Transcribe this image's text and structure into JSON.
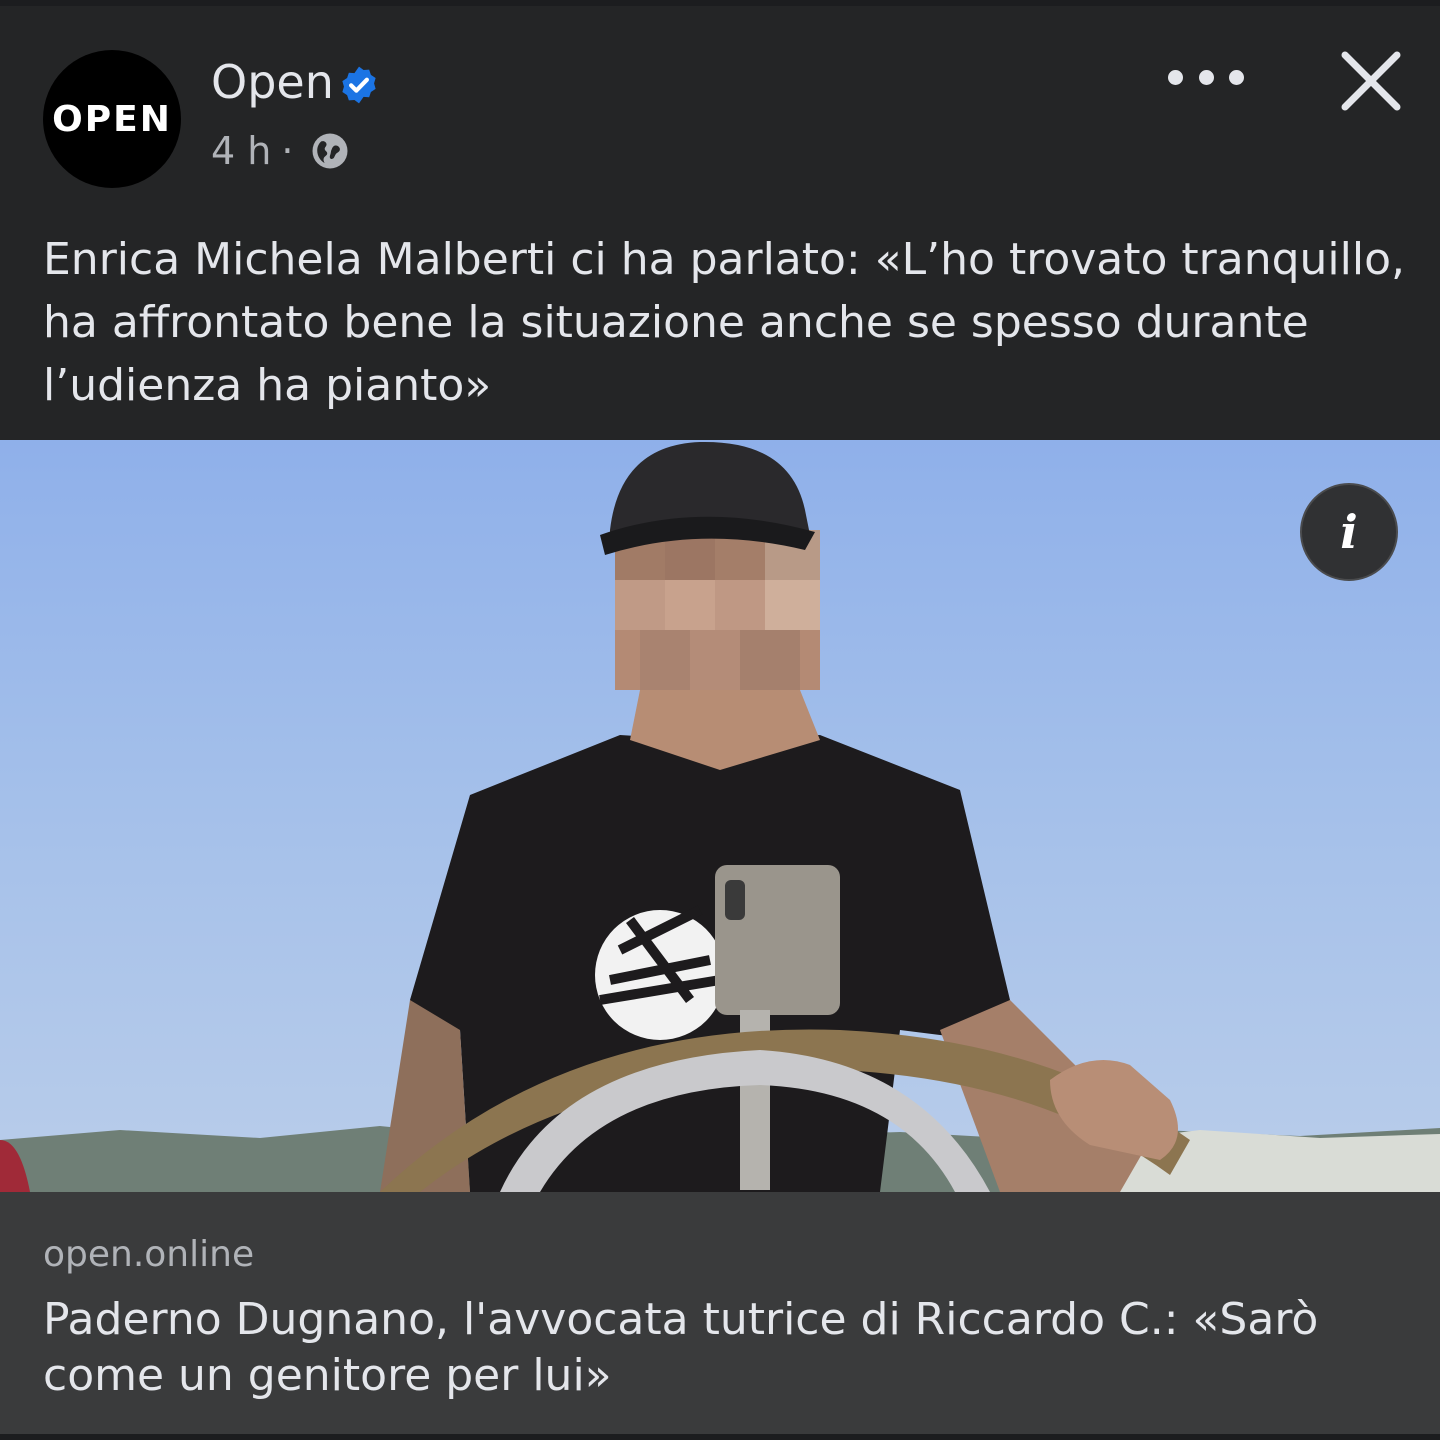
{
  "post": {
    "page_name": "Open",
    "avatar_text": "OPEN",
    "time": "4 h",
    "separator": "·",
    "caption": "Enrica Michela Malberti ci ha parlato: «L’ho trovato tranquillo, ha affrontato bene la situazione anche se spesso durante l’udienza ha pianto»",
    "image_alt": "Foto",
    "info_label": "i"
  },
  "link": {
    "domain": "open.online",
    "title": "Paderno Dugnano, l'avvocata tutrice di Riccardo C.: «Sarò come un genitore per lui»"
  },
  "icons": {
    "verified": "verified-badge-icon",
    "globe": "globe-icon",
    "more": "more-options-icon",
    "close": "close-icon",
    "info": "info-icon"
  },
  "colors": {
    "background": "#242526",
    "card": "#3a3b3c",
    "text": "#e4e6eb",
    "secondary_text": "#b0b3b8",
    "verified": "#1b74e4"
  }
}
